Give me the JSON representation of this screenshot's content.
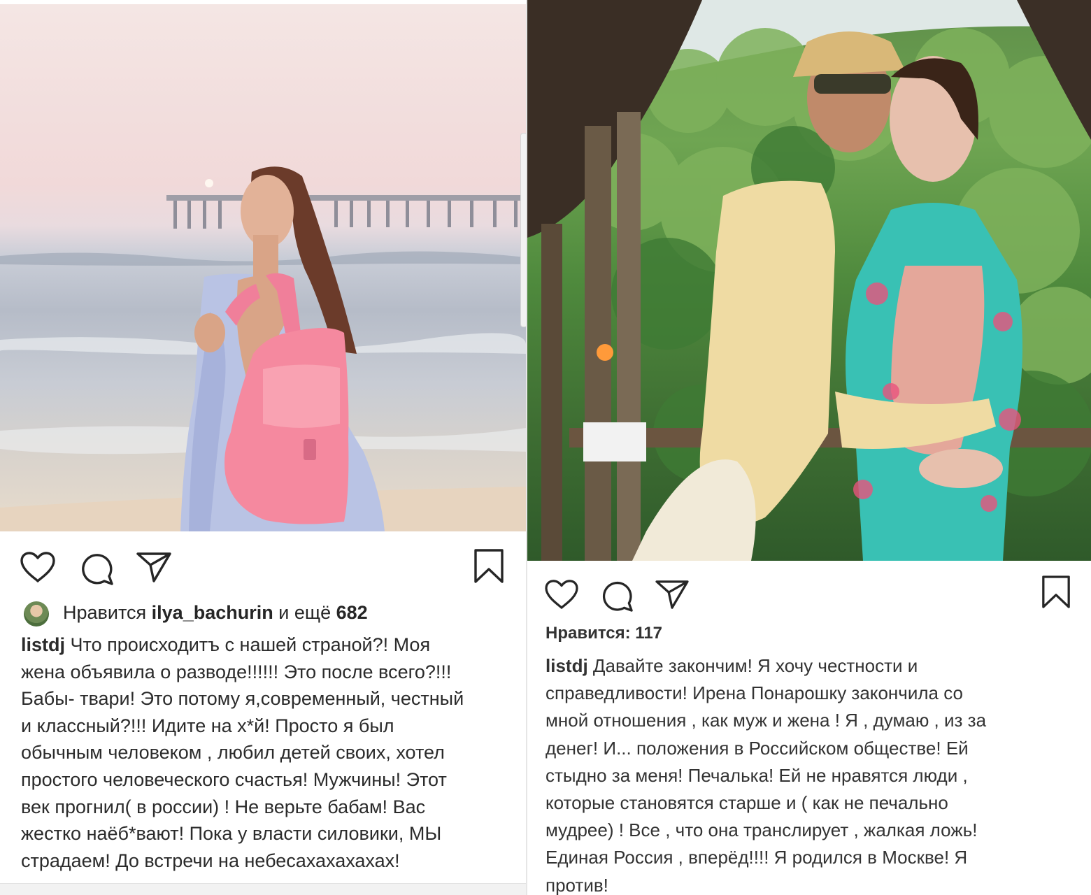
{
  "left_post": {
    "likes_prefix": "Нравится",
    "liker": "ilya_bachurin",
    "likes_mid": "и ещё",
    "likes_count": "682",
    "username": "listdj",
    "caption": " Что происходитъ с нашей страной?! Моя\nжена объявила о разводе!!!!!! Это  после всего?!!!\nБабы- твари! Это потому я,современный, честный\nи классный?!!! Идите на х*й!  Просто я был\nобычным человеком , любил детей своих, хотел\nпростого человеческого счастья! Мужчины! Этот\nвек прогнил( в россии) ! Не верьте бабам! Вас\nжестко наёб*вают! Пока у власти силовики, МЫ\nстрадаем! До встречи на небесахахахахах!"
  },
  "right_post": {
    "likes_text": "Нравится: 117",
    "username": "listdj",
    "caption": " Давайте  закончим! Я хочу честности и\nсправедливости! Ирена Понарошку закончила со\nмной отношения , как муж и жена ! Я , думаю , из за\nденег! И... положения в Российском обществе! Ей\nстыдно за меня! Печалька! Ей не нравятся люди ,\nкоторые становятся старше и ( как не печально\nмудрее) ! Все , что она транслирует , жалкая ложь!\nЕдиная Россия , вперёд!!!! Я родился в Москве! Я\nпротив!"
  },
  "icons": [
    "heart-icon",
    "comment-icon",
    "share-icon",
    "bookmark-icon"
  ]
}
